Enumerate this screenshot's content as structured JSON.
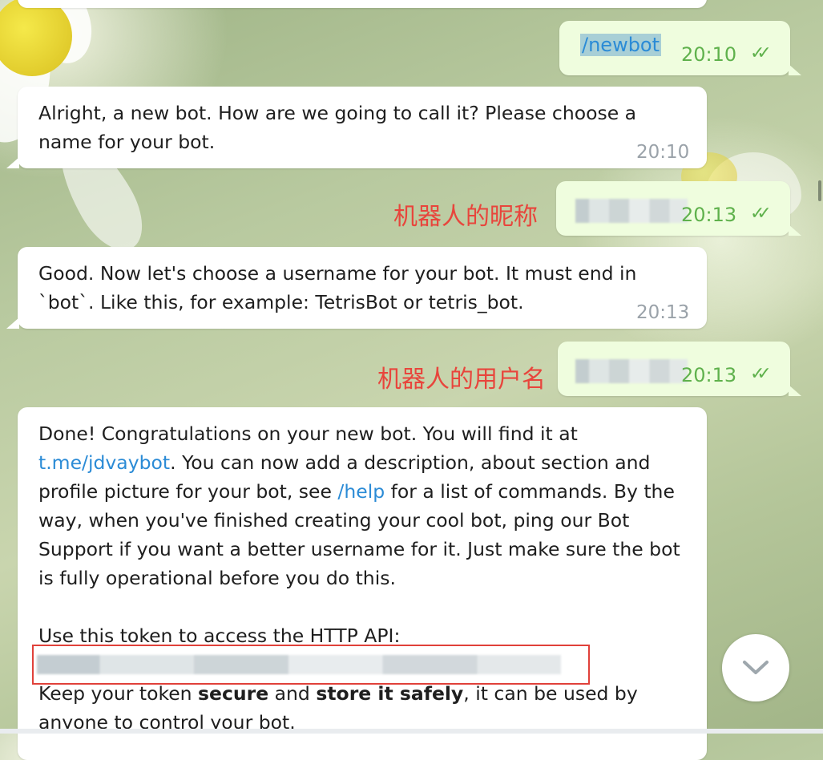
{
  "messages": {
    "cmd_newbot": {
      "text": "/newbot",
      "time": "20:10"
    },
    "reply_name": {
      "text": "Alright, a new bot. How are we going to call it? Please choose a name for your bot.",
      "time": "20:10"
    },
    "sent_nickname": {
      "time": "20:13",
      "annotation": "机器人的昵称"
    },
    "reply_username": {
      "text": "Good. Now let's choose a username for your bot. It must end in `bot`. Like this, for example: TetrisBot or tetris_bot.",
      "time": "20:13"
    },
    "sent_username": {
      "time": "20:13",
      "annotation": "机器人的用户名"
    },
    "done": {
      "p1_a": "Done! Congratulations on your new bot. You will find it at ",
      "link_tme": "t.me/jdvaybot",
      "p1_b": ". You can now add a description, about section and profile picture for your bot, see ",
      "link_help": "/help",
      "p1_c": " for a list of commands. By the way, when you've finished creating your cool bot, ping our Bot Support if you want a better username for it. Just make sure the bot is fully operational before you do this.",
      "token_label": "Use this token to access the HTTP API:",
      "p3_a": "Keep your token ",
      "p3_b": "secure",
      "p3_c": " and ",
      "p3_d": "store it safely",
      "p3_e": ", it can be used by anyone to control your bot."
    }
  },
  "icons": {
    "read_checks": "double-check-icon",
    "scroll_down": "chevron-down-icon"
  },
  "colors": {
    "incoming_bg": "#ffffff",
    "outgoing_bg": "#effdde",
    "time_out": "#5fb14c",
    "link": "#2b8bd6",
    "annotation": "#e8453c"
  }
}
